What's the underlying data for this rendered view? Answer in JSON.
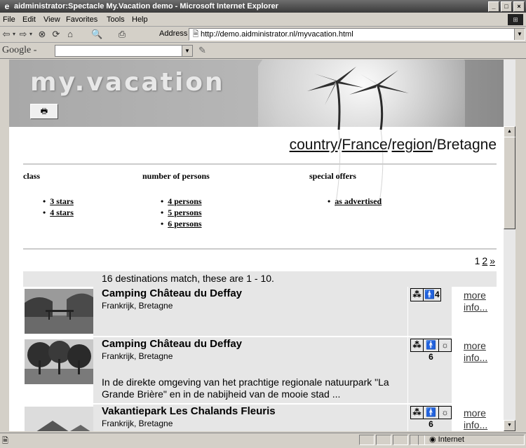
{
  "window": {
    "title": "aidministrator:Spectacle My.Vacation demo - Microsoft Internet Explorer",
    "minimize_label": "_",
    "maximize_label": "□",
    "close_label": "×"
  },
  "menu": [
    "File",
    "Edit",
    "View",
    "Favorites",
    "Tools",
    "Help"
  ],
  "toolbar": {
    "address_label": "Address",
    "address_value": "http://demo.aidministrator.nl/myvacation.html"
  },
  "google": {
    "logo": "Google -",
    "search_value": ""
  },
  "page": {
    "logo": "my.vacation",
    "breadcrumb": {
      "country": "country",
      "sep1": "/",
      "france": "France",
      "sep2": "/",
      "region": "region",
      "sep3": "/",
      "bretagne": "Bretagne"
    },
    "filters": {
      "class": {
        "title": "class",
        "items": [
          "3 stars",
          "4 stars"
        ]
      },
      "persons": {
        "title": "number of persons",
        "items": [
          "4 persons",
          "5 persons",
          "6 persons"
        ]
      },
      "offers": {
        "title": "special offers",
        "items": [
          "as advertised"
        ]
      }
    },
    "paging": {
      "current": "1",
      "next_page": "2",
      "next": "»"
    },
    "match_text": "16 destinations match, these are 1 - 10.",
    "results": [
      {
        "name": "Camping Château du Deffay",
        "place": "Frankrijk, Bretagne",
        "stars": "⁂",
        "persons": "🚹4",
        "sun": "",
        "description": "",
        "more": "more info..."
      },
      {
        "name": "Camping Château du Deffay",
        "place": "Frankrijk, Bretagne",
        "stars": "⁂",
        "persons": "🚹6",
        "sun": "☼",
        "description": "In de direkte omgeving van het prachtige regionale natuurpark \"La Grande Brière\" en in de nabijheid van de mooie stad ...",
        "more": "more info..."
      },
      {
        "name": "Vakantiepark Les Chalands Fleuris",
        "place": "Frankrijk, Bretagne",
        "stars": "⁂",
        "persons": "🚹6",
        "sun": "☼",
        "description": "",
        "more": "more info..."
      }
    ]
  },
  "status": {
    "zone": "Internet"
  },
  "colors": {
    "titlebar": "#4a4a4a",
    "chrome": "#d4d0c8",
    "row_bg": "#e6e6e6"
  }
}
